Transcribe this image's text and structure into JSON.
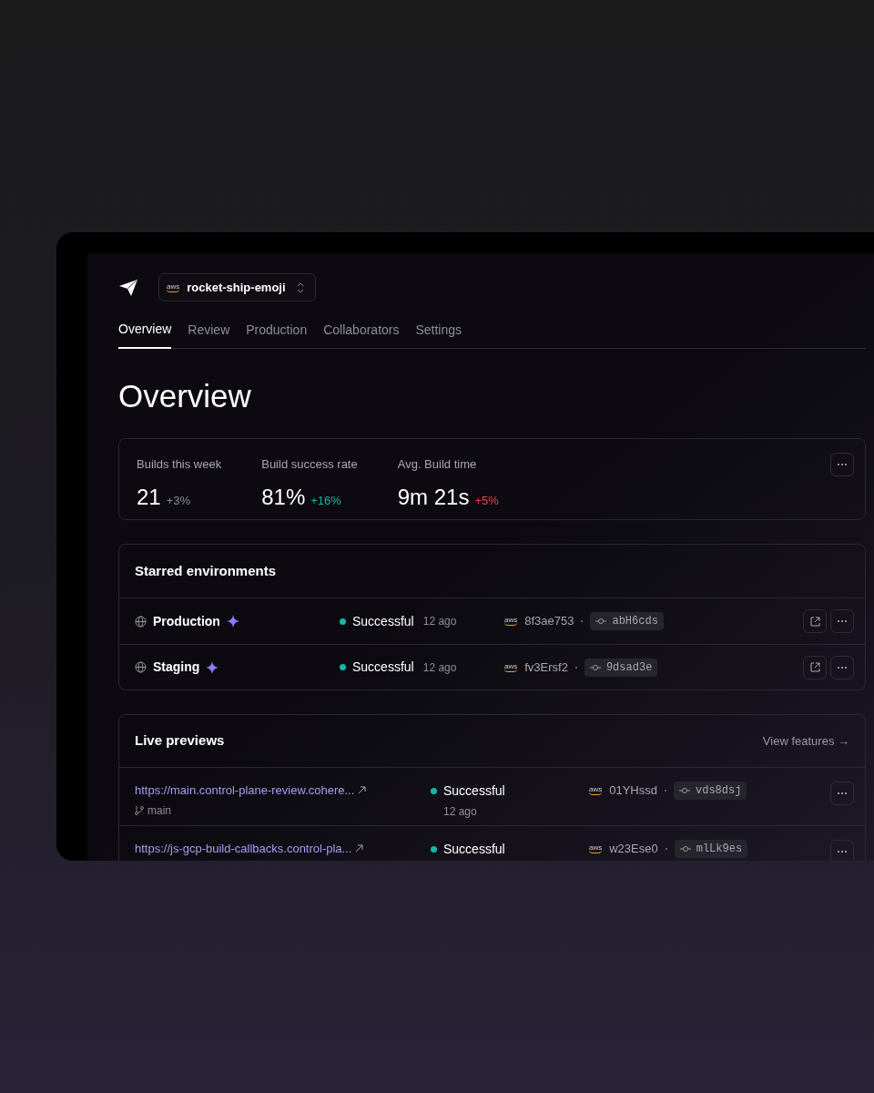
{
  "project": {
    "provider": "aws",
    "name": "rocket-ship-emoji"
  },
  "tabs": [
    {
      "label": "Overview",
      "selected": true
    },
    {
      "label": "Review",
      "selected": false
    },
    {
      "label": "Production",
      "selected": false
    },
    {
      "label": "Collaborators",
      "selected": false
    },
    {
      "label": "Settings",
      "selected": false
    }
  ],
  "title": "Overview",
  "stats": [
    {
      "label": "Builds this week",
      "value": "21",
      "delta": "+3%",
      "color": "#8a8a94"
    },
    {
      "label": "Build success rate",
      "value": "81%",
      "delta": "+16%",
      "color": "#14b8a6"
    },
    {
      "label": "Avg. Build time",
      "value": "9m 21s",
      "delta": "+5%",
      "color": "#ef4444"
    }
  ],
  "starred": {
    "title": "Starred environments",
    "rows": [
      {
        "name": "Production",
        "status": "Successful",
        "color": "#14b8a6",
        "time": "12 ago",
        "provider": "aws",
        "build": "8f3ae753",
        "commit": "abH6cds"
      },
      {
        "name": "Staging",
        "status": "Successful",
        "color": "#14b8a6",
        "time": "12 ago",
        "provider": "aws",
        "build": "fv3Ersf2",
        "commit": "9dsad3e"
      }
    ]
  },
  "previews": {
    "title": "Live previews",
    "link": "View features →",
    "rows": [
      {
        "url": "https://main.control-plane-review.cohere...",
        "branch": "main",
        "status": "Successful",
        "color": "#14b8a6",
        "time": "12 ago",
        "provider": "aws",
        "build": "01YHssd",
        "commit": "vds8dsj"
      },
      {
        "url": "https://js-gcp-build-callbacks.control-pla...",
        "status": "Successful",
        "color": "#14b8a6",
        "provider": "aws",
        "build": "w23Ese0",
        "commit": "mlLk9es"
      }
    ]
  }
}
